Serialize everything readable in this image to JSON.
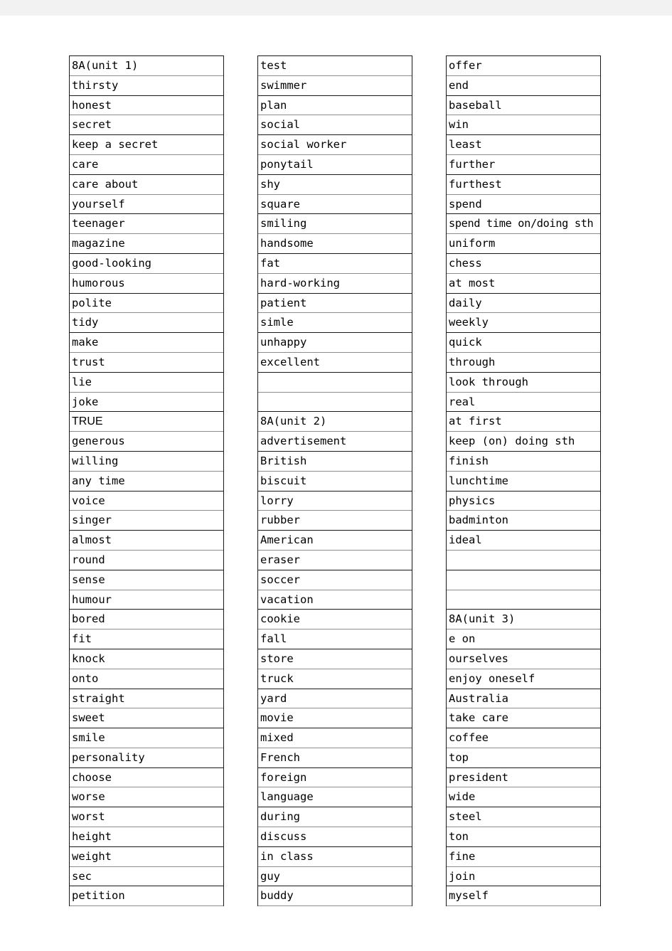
{
  "page": {
    "title": "8A Word List",
    "background_color": "#ffffff",
    "band_color": "#f2f2f2",
    "border_color": "#1a1a1a",
    "rule_color": "#8c8c8c",
    "text_color": "#000000"
  },
  "columns": [
    {
      "name": "column-1",
      "rows": [
        "8A(unit 1)",
        "thirsty",
        "honest",
        "secret",
        "keep a secret",
        "care",
        "care about",
        "yourself",
        "teenager",
        "magazine",
        "good-looking",
        "humorous",
        "polite",
        "tidy",
        "make",
        "trust",
        "lie",
        "joke",
        "TRUE",
        "generous",
        "willing",
        "any time",
        "voice",
        "singer",
        "almost",
        "round",
        "sense",
        "humour",
        "bored",
        "fit",
        "knock",
        "onto",
        "straight",
        "sweet",
        "smile",
        "personality",
        "choose",
        "worse",
        "worst",
        "height",
        "weight",
        "sec",
        "petition"
      ]
    },
    {
      "name": "column-2",
      "rows": [
        "test",
        "swimmer",
        "plan",
        "social",
        "social worker",
        "ponytail",
        "shy",
        "square",
        "smiling",
        "handsome",
        "fat",
        "hard-working",
        "patient",
        "simle",
        "unhappy",
        "excellent",
        "",
        "",
        "8A(unit 2)",
        "advertisement",
        "British",
        "biscuit",
        "lorry",
        "rubber",
        "American",
        "eraser",
        "soccer",
        "vacation",
        "cookie",
        "fall",
        "store",
        "truck",
        "yard",
        "movie",
        "mixed",
        "French",
        "foreign",
        "language",
        "during",
        "discuss",
        "in class",
        "guy",
        "buddy"
      ]
    },
    {
      "name": "column-3",
      "rows": [
        "offer",
        "end",
        "baseball",
        "win",
        "least",
        "further",
        "furthest",
        "spend",
        "spend time on/doing sth",
        "uniform",
        "chess",
        "at most",
        "daily",
        "weekly",
        "quick",
        "through",
        "look through",
        "real",
        "at first",
        "keep (on) doing sth",
        "finish",
        "lunchtime",
        "physics",
        "badminton",
        "ideal",
        "",
        "",
        "",
        "8A(unit 3)",
        "e on",
        "ourselves",
        "enjoy oneself",
        "Australia",
        "take care",
        "coffee",
        "top",
        "president",
        "wide",
        "steel",
        "ton",
        "fine",
        "join",
        "myself"
      ]
    }
  ]
}
